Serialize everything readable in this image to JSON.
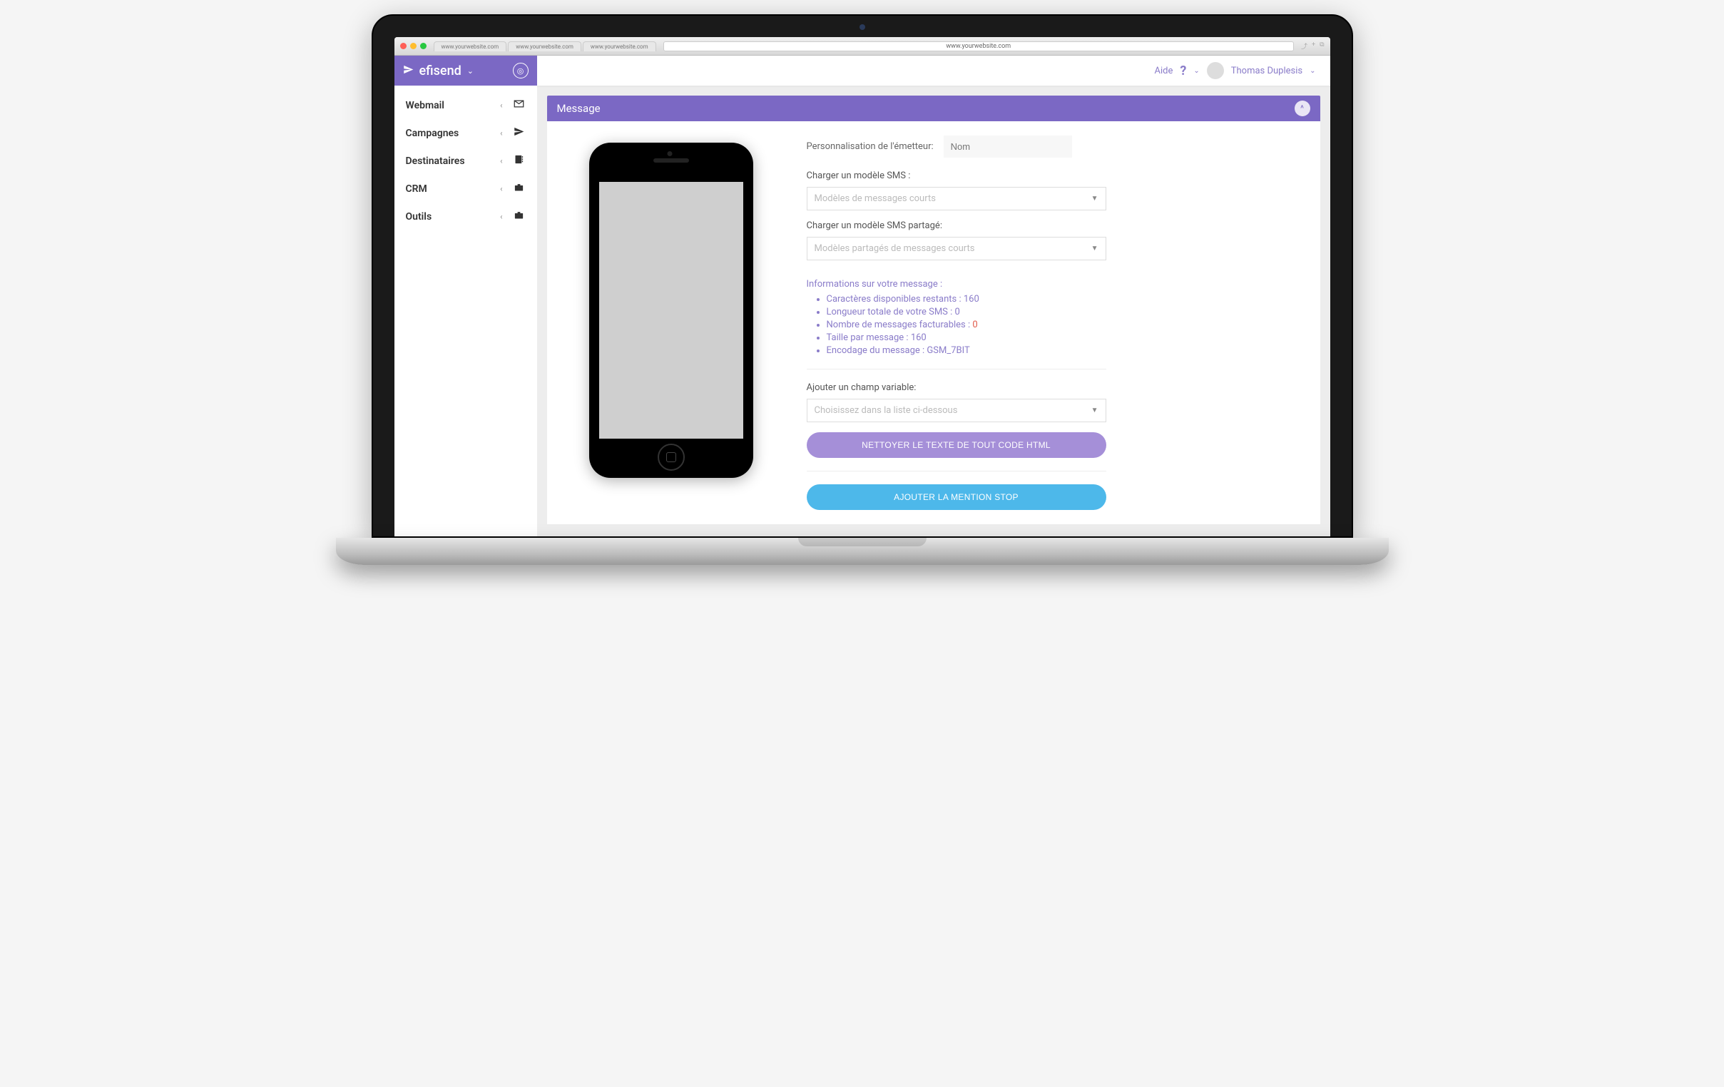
{
  "browser": {
    "tabs": [
      "www.yourwebsite.com",
      "www.yourwebsite.com",
      "www.yourwebsite.com"
    ],
    "address": "www.yourwebsite.com"
  },
  "brand": {
    "name": "efisend"
  },
  "sidebar": {
    "items": [
      {
        "label": "Webmail",
        "icon": "mail"
      },
      {
        "label": "Campagnes",
        "icon": "send"
      },
      {
        "label": "Destinataires",
        "icon": "contacts"
      },
      {
        "label": "CRM",
        "icon": "briefcase"
      },
      {
        "label": "Outils",
        "icon": "briefcase"
      }
    ]
  },
  "topbar": {
    "help": "Aide",
    "user": "Thomas Duplesis"
  },
  "panel": {
    "title": "Message"
  },
  "form": {
    "sender_label": "Personnalisation de l'émetteur:",
    "sender_placeholder": "Nom",
    "load_model_label": "Charger un modèle SMS :",
    "model_select_placeholder": "Modèles de messages courts",
    "load_shared_label": "Charger un modèle SMS partagé:",
    "shared_select_placeholder": "Modèles partagés de messages courts",
    "add_variable_label": "Ajouter un champ variable:",
    "variable_select_placeholder": "Choisissez dans la liste ci-dessous",
    "btn_clean": "NETTOYER LE TEXTE DE TOUT CODE HTML",
    "btn_stop": "AJOUTER LA MENTION STOP"
  },
  "info": {
    "heading": "Informations sur votre message :",
    "chars_label": "Caractères disponibles restants :",
    "chars_value": "160",
    "length_label": "Longueur totale de votre SMS :",
    "length_value": "0",
    "billable_label": "Nombre de messages facturables :",
    "billable_value": "0",
    "size_label": "Taille par message :",
    "size_value": "160",
    "encoding_label": "Encodage du message :",
    "encoding_value": "GSM_7BIT"
  }
}
